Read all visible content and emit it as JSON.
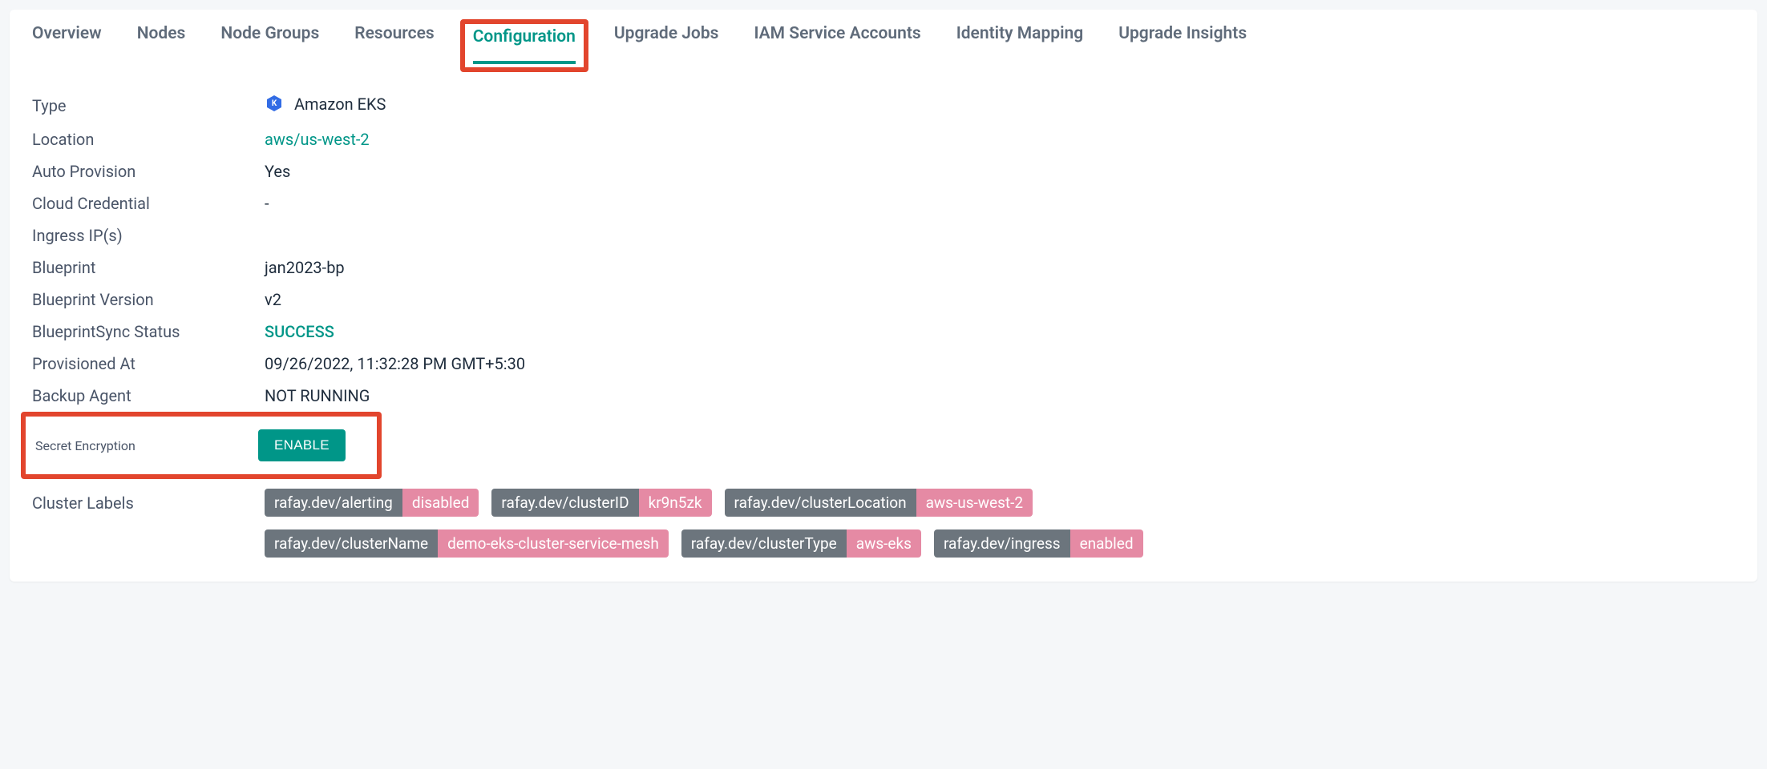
{
  "tabs": {
    "overview": "Overview",
    "nodes": "Nodes",
    "node_groups": "Node Groups",
    "resources": "Resources",
    "configuration": "Configuration",
    "upgrade_jobs": "Upgrade Jobs",
    "iam_service_accounts": "IAM Service Accounts",
    "identity_mapping": "Identity Mapping",
    "upgrade_insights": "Upgrade Insights"
  },
  "fields": {
    "type_label": "Type",
    "type_value": "Amazon EKS",
    "location_label": "Location",
    "location_value": "aws/us-west-2",
    "auto_provision_label": "Auto Provision",
    "auto_provision_value": "Yes",
    "cloud_credential_label": "Cloud Credential",
    "cloud_credential_value": "-",
    "ingress_ips_label": "Ingress IP(s)",
    "ingress_ips_value": "",
    "blueprint_label": "Blueprint",
    "blueprint_value": "jan2023-bp",
    "blueprint_version_label": "Blueprint Version",
    "blueprint_version_value": "v2",
    "blueprint_sync_label": "BlueprintSync Status",
    "blueprint_sync_value": "SUCCESS",
    "provisioned_at_label": "Provisioned At",
    "provisioned_at_value": "09/26/2022, 11:32:28 PM GMT+5:30",
    "backup_agent_label": "Backup Agent",
    "backup_agent_value": "NOT RUNNING",
    "secret_encryption_label": "Secret Encryption",
    "secret_encryption_button": "ENABLE",
    "cluster_labels_label": "Cluster Labels"
  },
  "cluster_labels": {
    "row1": [
      {
        "k": "rafay.dev/alerting",
        "v": "disabled"
      },
      {
        "k": "rafay.dev/clusterID",
        "v": "kr9n5zk"
      },
      {
        "k": "rafay.dev/clusterLocation",
        "v": "aws-us-west-2"
      }
    ],
    "row2": [
      {
        "k": "rafay.dev/clusterName",
        "v": "demo-eks-cluster-service-mesh"
      },
      {
        "k": "rafay.dev/clusterType",
        "v": "aws-eks"
      },
      {
        "k": "rafay.dev/ingress",
        "v": "enabled"
      }
    ]
  }
}
